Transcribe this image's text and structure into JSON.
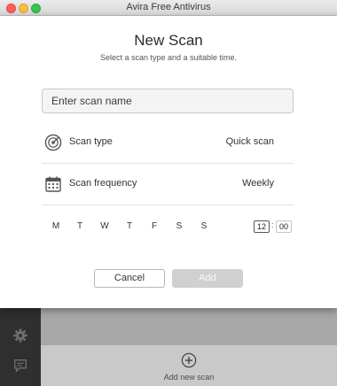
{
  "window": {
    "title": "Avira Free Antivirus"
  },
  "dialog": {
    "title": "New Scan",
    "subtitle": "Select a scan type and a suitable time.",
    "name_placeholder": "Enter scan name",
    "scan_type": {
      "label": "Scan type",
      "value": "Quick scan",
      "icon": "radar-icon"
    },
    "scan_frequency": {
      "label": "Scan frequency",
      "value": "Weekly",
      "icon": "calendar-icon"
    },
    "days": [
      "M",
      "T",
      "W",
      "T",
      "F",
      "S",
      "S"
    ],
    "time": {
      "hour": "12",
      "separator": ":",
      "minute": "00"
    },
    "cancel_label": "Cancel",
    "add_label": "Add"
  },
  "background": {
    "add_new_label": "Add new scan",
    "sidebar_icons": [
      "gear-icon",
      "chat-icon"
    ]
  },
  "colors": {
    "sheet_bg": "#ffffff",
    "add_button_disabled": "#d0d0d0",
    "rail_bg": "#2f2f2f",
    "close_red": "#fc605c",
    "minimize_yellow": "#fdbc40",
    "zoom_green": "#34c84a"
  }
}
